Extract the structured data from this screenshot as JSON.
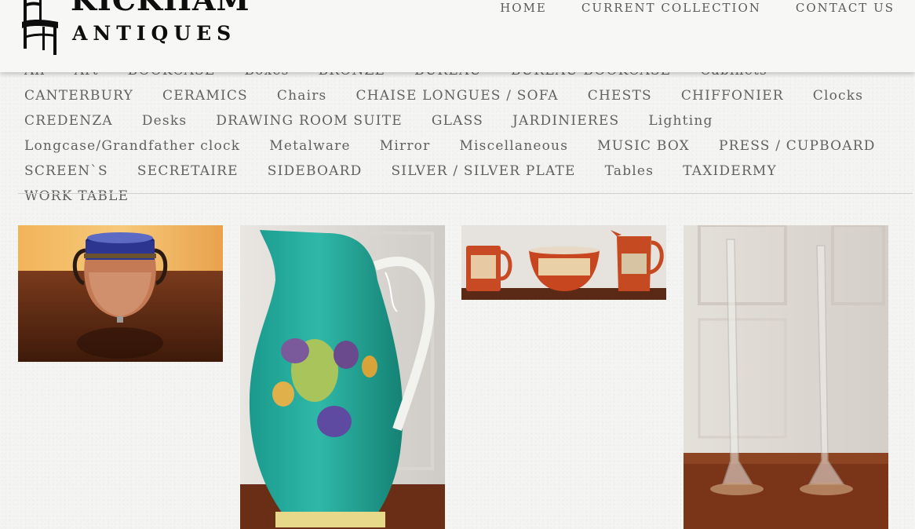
{
  "brand": {
    "name_line1": "KICKHAM",
    "name_line2": "ANTIQUES"
  },
  "topnav": [
    {
      "label": "HOME"
    },
    {
      "label": "CURRENT COLLECTION"
    },
    {
      "label": "CONTACT US"
    }
  ],
  "categories": [
    {
      "label": "All"
    },
    {
      "label": "Art"
    },
    {
      "label": "BOOKCASE"
    },
    {
      "label": "Boxes"
    },
    {
      "label": "BRONZE"
    },
    {
      "label": "BUREAU"
    },
    {
      "label": "BUREAU BOOKCASE"
    },
    {
      "label": "Cabinets"
    },
    {
      "label": "CANTERBURY"
    },
    {
      "label": "CERAMICS"
    },
    {
      "label": "Chairs"
    },
    {
      "label": "CHAISE LONGUES / SOFA"
    },
    {
      "label": "CHESTS"
    },
    {
      "label": "CHIFFONIER"
    },
    {
      "label": "Clocks"
    },
    {
      "label": "CREDENZA"
    },
    {
      "label": "Desks"
    },
    {
      "label": "DRAWING ROOM SUITE"
    },
    {
      "label": "GLASS"
    },
    {
      "label": "JARDINIERES"
    },
    {
      "label": "Lighting"
    },
    {
      "label": "Longcase/Grandfather clock"
    },
    {
      "label": "Metalware"
    },
    {
      "label": "Mirror"
    },
    {
      "label": "Miscellaneous"
    },
    {
      "label": "MUSIC BOX"
    },
    {
      "label": "PRESS / CUPBOARD"
    },
    {
      "label": "SCREEN`S"
    },
    {
      "label": "SECRETAIRE"
    },
    {
      "label": "SIDEBOARD"
    },
    {
      "label": "SILVER / SILVER PLATE"
    },
    {
      "label": "Tables"
    },
    {
      "label": "TAXIDERMY"
    },
    {
      "label": "WORK TABLE"
    }
  ],
  "gallery": [
    {
      "subject": "ceramic-pot-image"
    },
    {
      "subject": "turquoise-jug-image"
    },
    {
      "subject": "mugs-and-bowl-image"
    },
    {
      "subject": "glass-vases-image"
    }
  ],
  "colors": {
    "page_bg": "#f4f4f2",
    "nav_text": "#616161",
    "logo": "#0d0d0d",
    "divider": "#cfcfcf"
  }
}
